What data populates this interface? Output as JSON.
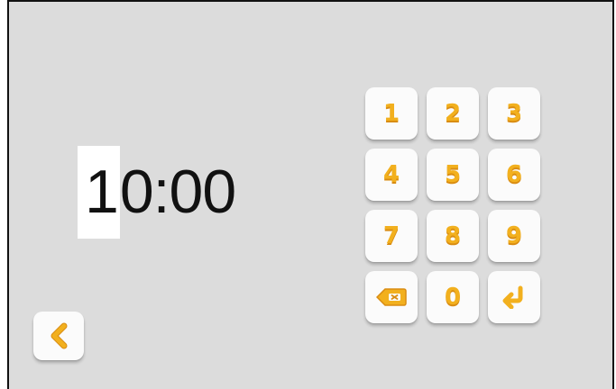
{
  "time": {
    "cursor_digit": "1",
    "rest": "0:00"
  },
  "keypad": {
    "keys": [
      "1",
      "2",
      "3",
      "4",
      "5",
      "6",
      "7",
      "8",
      "9",
      "",
      "0",
      ""
    ],
    "backspace_icon": "backspace-icon",
    "enter_icon": "enter-arrow-icon"
  },
  "back_button": {
    "icon": "chevron-left-icon"
  },
  "colors": {
    "background": "#dcdcdc",
    "key_face": "#fbfbfb",
    "accent": "#f2b01e",
    "accent_dark": "#d98c12",
    "text": "#111111"
  }
}
